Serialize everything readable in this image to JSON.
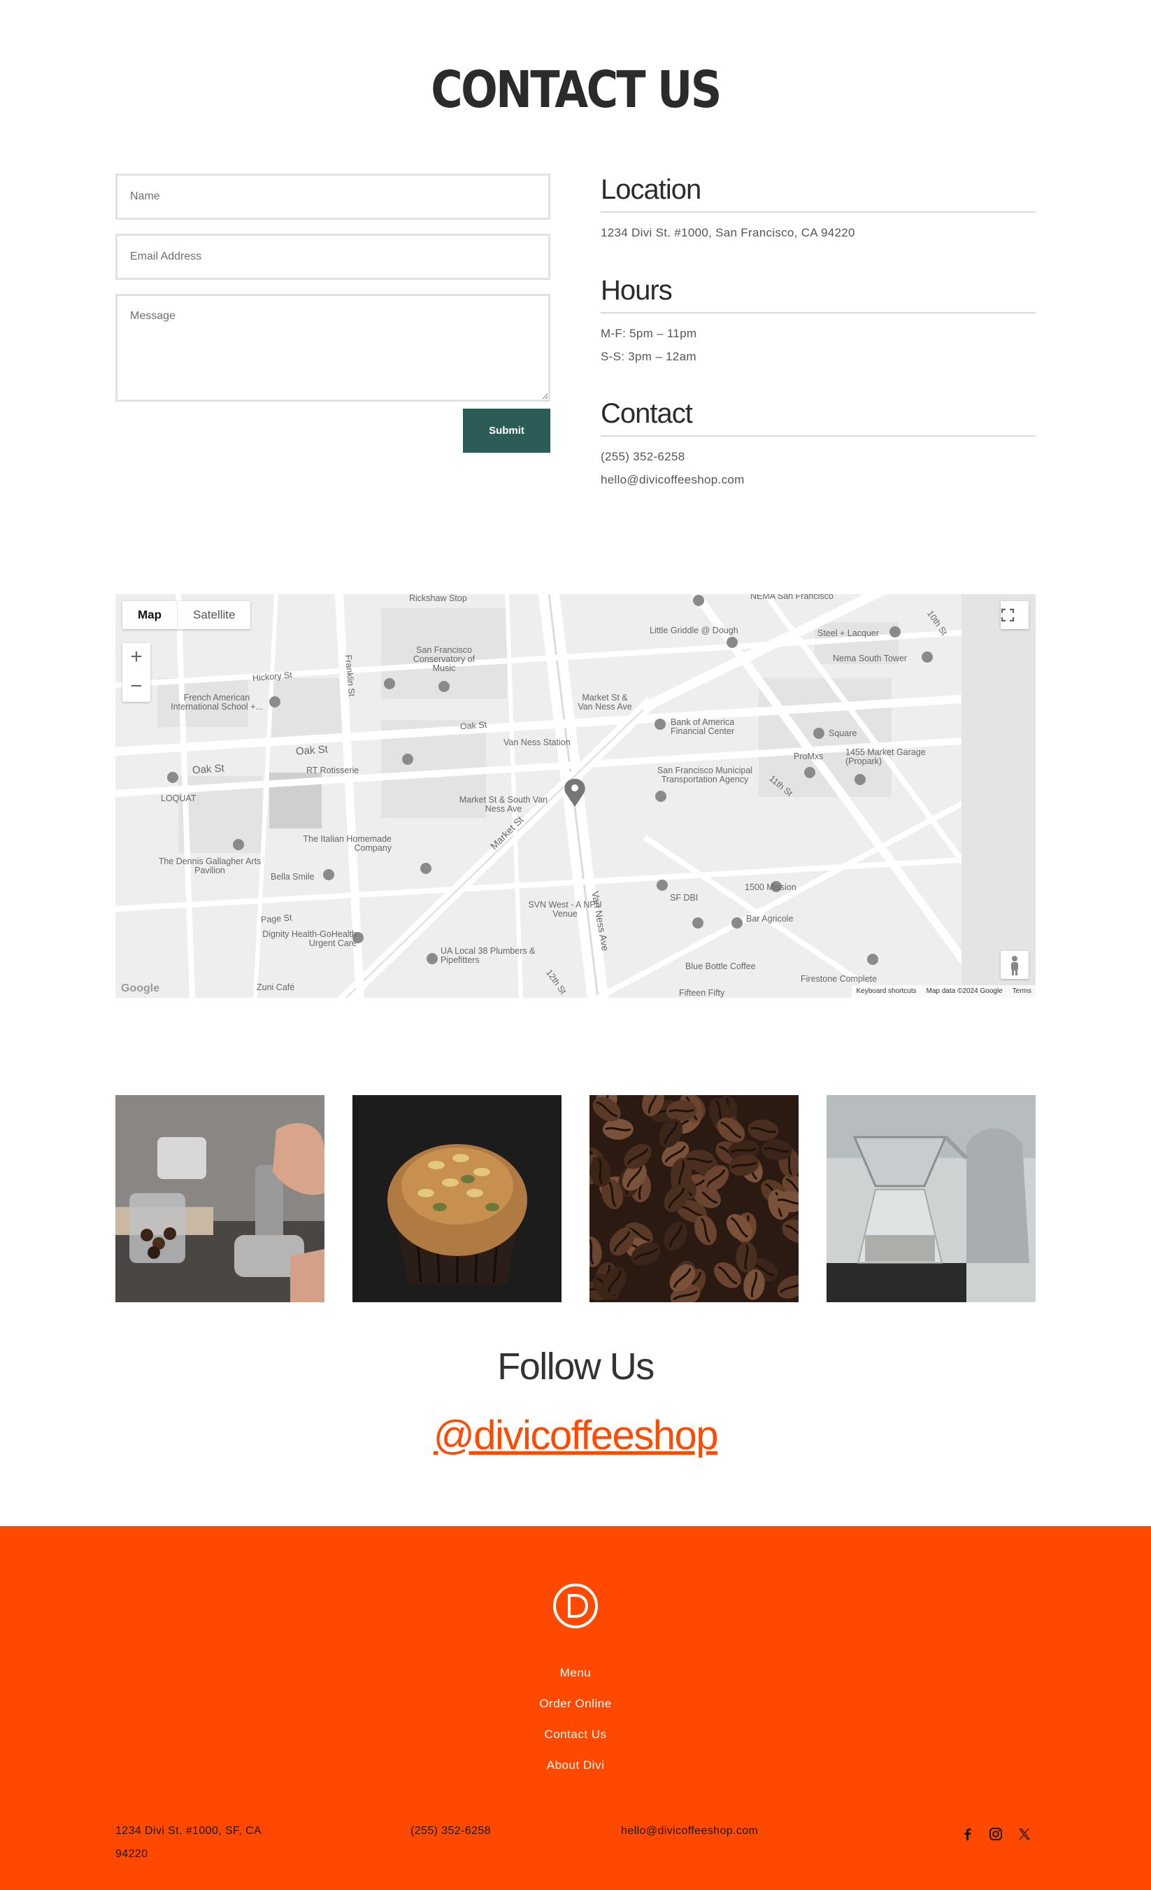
{
  "page_title": "CONTACT US",
  "form": {
    "name_placeholder": "Name",
    "email_placeholder": "Email Address",
    "message_placeholder": "Message",
    "submit_label": "Submit"
  },
  "info": {
    "location": {
      "heading": "Location",
      "text": "1234 Divi St. #1000, San Francisco, CA 94220"
    },
    "hours": {
      "heading": "Hours",
      "lines": [
        "M-F: 5pm – 11pm",
        "S-S: 3pm – 12am"
      ]
    },
    "contact": {
      "heading": "Contact",
      "phone": "(255) 352-6258",
      "email": "hello@divicoffeeshop.com"
    }
  },
  "map": {
    "tab_map": "Map",
    "tab_satellite": "Satellite",
    "zoom_in": "+",
    "zoom_out": "−",
    "fullscreen_icon": "fullscreen-icon",
    "logo": "Google",
    "footer": [
      "Keyboard shortcuts",
      "Map data ©2024 Google",
      "Terms"
    ],
    "labels": [
      "Rickshaw Stop",
      "NEMA San Francisco",
      "Little Griddle @ Dough",
      "Steel + Lacquer",
      "10th St",
      "Nema South Tower",
      "San Francisco Conservatory of Music",
      "Franklin St",
      "Hickory St",
      "French American International School +...",
      "Oak St",
      "Oak St",
      "Oak St",
      "RT Rotisserie",
      "LOQUAT",
      "Market St & Van Ness Ave",
      "Van Ness Station",
      "Bank of America Financial Center",
      "Square",
      "ProMxs",
      "1455 Market Garage (Propark)",
      "San Francisco Municipal Transportation Agency",
      "11th St",
      "Market St & South Van Ness Ave",
      "Market St",
      "The Italian Homemade Company",
      "The Dennis Gallagher Arts Pavilion",
      "Bella Smile",
      "SVN West - A NPU Venue",
      "Van Ness Ave",
      "1500 Mission",
      "SF DBI",
      "Bar Agricole",
      "Page St",
      "Dignity Health-GoHealth Urgent Care",
      "UA Local 38 Plumbers & Pipefitters",
      "Blue Bottle Coffee",
      "Firestone Complete",
      "12th St",
      "Zuni Café",
      "Fifteen Fifty"
    ]
  },
  "gallery": [
    {
      "alt": "coffee-tamping-photo"
    },
    {
      "alt": "muffin-photo"
    },
    {
      "alt": "coffee-beans-photo"
    },
    {
      "alt": "pour-over-photo"
    }
  ],
  "follow": {
    "title": "Follow Us",
    "handle": "@divicoffeeshop"
  },
  "footer": {
    "nav": [
      "Menu",
      "Order Online",
      "Contact Us",
      "About Divi"
    ],
    "address_line1": "1234 Divi St. #1000, SF, CA",
    "address_line2": "94220",
    "phone": "(255) 352-6258",
    "email": "hello@divicoffeeshop.com",
    "social_icons": [
      "facebook-icon",
      "instagram-icon",
      "x-icon"
    ]
  },
  "colors": {
    "accent": "#ff4a00",
    "submit": "#2c5c58",
    "text": "#333333"
  }
}
